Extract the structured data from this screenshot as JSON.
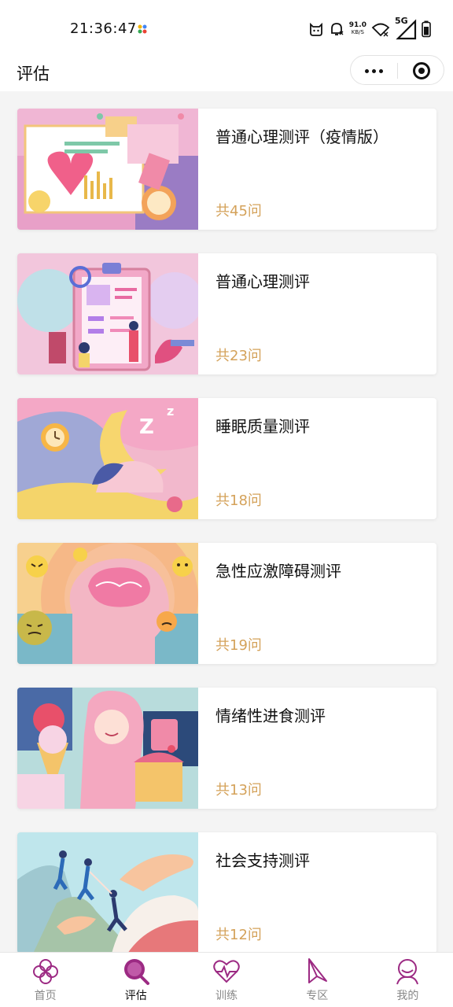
{
  "status_bar": {
    "time": "21:36:47",
    "net_speed_value": "91.0",
    "net_speed_unit": "KB/S",
    "network_type": "5G"
  },
  "header": {
    "title": "评估"
  },
  "assessments": [
    {
      "title": "普通心理测评（疫情版）",
      "count": "共45问"
    },
    {
      "title": "普通心理测评",
      "count": "共23问"
    },
    {
      "title": "睡眠质量测评",
      "count": "共18问"
    },
    {
      "title": "急性应激障碍测评",
      "count": "共19问"
    },
    {
      "title": "情绪性进食测评",
      "count": "共13问"
    },
    {
      "title": "社会支持测评",
      "count": "共12问"
    }
  ],
  "tabbar": {
    "accent_color": "#9c2a83",
    "items": [
      {
        "label": "首页",
        "icon": "clover-icon"
      },
      {
        "label": "评估",
        "icon": "search-magnifier-icon",
        "active": true
      },
      {
        "label": "训练",
        "icon": "heartbeat-icon"
      },
      {
        "label": "专区",
        "icon": "paper-plane-icon"
      },
      {
        "label": "我的",
        "icon": "user-icon"
      }
    ]
  }
}
